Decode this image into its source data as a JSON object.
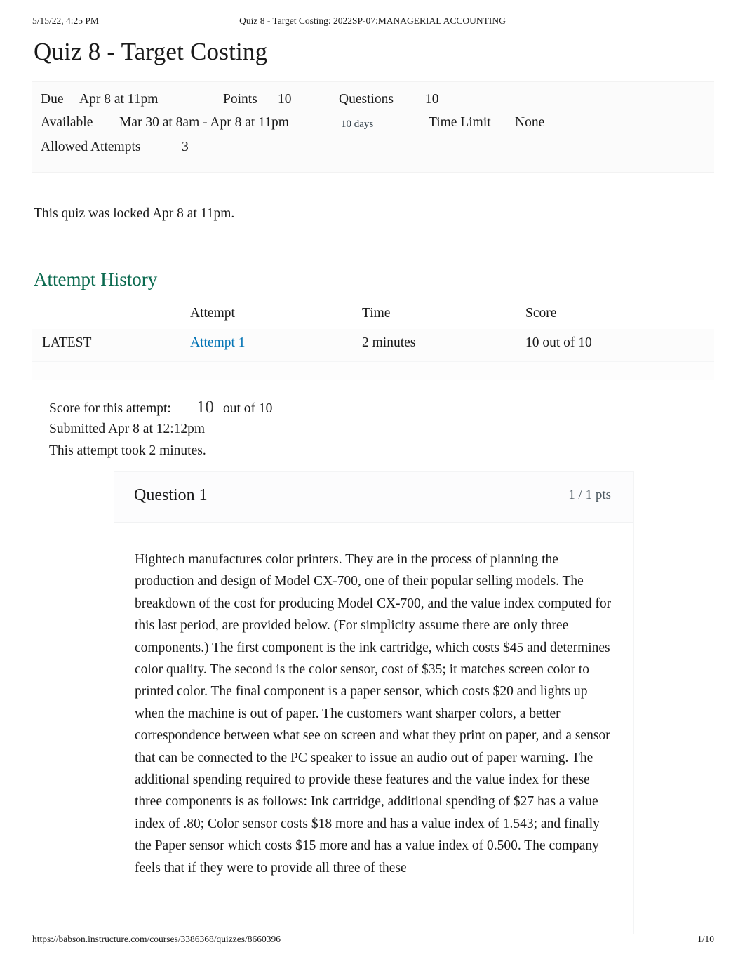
{
  "print_header": {
    "date": "5/15/22, 4:25 PM",
    "title": "Quiz 8 - Target Costing: 2022SP-07:MANAGERIAL ACCOUNTING"
  },
  "page_title": "Quiz 8 - Target Costing",
  "quiz_details": {
    "due_label": "Due",
    "due_value": "Apr 8 at 11pm",
    "points_label": "Points",
    "points_value": "10",
    "questions_label": "Questions",
    "questions_value": "10",
    "available_label": "Available",
    "available_value": "Mar 30 at 8am - Apr 8 at 11pm",
    "available_duration": "10 days",
    "time_limit_label": "Time Limit",
    "time_limit_value": "None",
    "allowed_attempts_label": "Allowed Attempts",
    "allowed_attempts_value": "3"
  },
  "locked_notice": "This quiz was locked Apr 8 at 11pm.",
  "attempt_history": {
    "heading": "Attempt History",
    "columns": [
      "",
      "Attempt",
      "Time",
      "Score"
    ],
    "rows": [
      {
        "marker": "LATEST",
        "attempt": "Attempt 1",
        "time": "2 minutes",
        "score": "10 out of 10"
      }
    ]
  },
  "attempt_summary": {
    "score_label": "Score for this attempt:",
    "score_value": "10",
    "score_out_of": "out of 10",
    "submitted": "Submitted Apr 8 at 12:12pm",
    "duration": "This attempt took 2 minutes."
  },
  "question": {
    "name": "Question 1",
    "points": "1 / 1 pts",
    "text": "Hightech manufactures color printers. They are in the process of planning the production and design of Model CX-700, one of their popular selling models. The breakdown of the cost for producing Model CX-700, and the value index computed for this last period, are provided below. (For simplicity assume there are only three components.) The first component is the ink cartridge, which costs $45 and determines color quality. The second is the color sensor, cost of $35; it matches screen color to printed color. The final component is a paper sensor, which costs $20 and lights up when the machine is out of paper. The customers want sharper colors, a better correspondence between what see on screen and what they print on paper, and a sensor that can be connected to the PC speaker to issue an audio out of paper warning. The additional spending required to provide these features and the value index for these three components is as follows: Ink cartridge, additional spending of $27 has a value index of .80; Color sensor costs $18 more and has a value index of 1.543; and finally the Paper sensor which costs $15 more and has a value index of 0.500. The company feels that if they were to provide all three of these"
  },
  "print_footer": {
    "url": "https://babson.instructure.com/courses/3386368/quizzes/8660396",
    "page": "1/10"
  },
  "colors": {
    "heading_green": "#0b6a4f",
    "link_blue": "#0374b5",
    "text": "#1a1a1a"
  }
}
